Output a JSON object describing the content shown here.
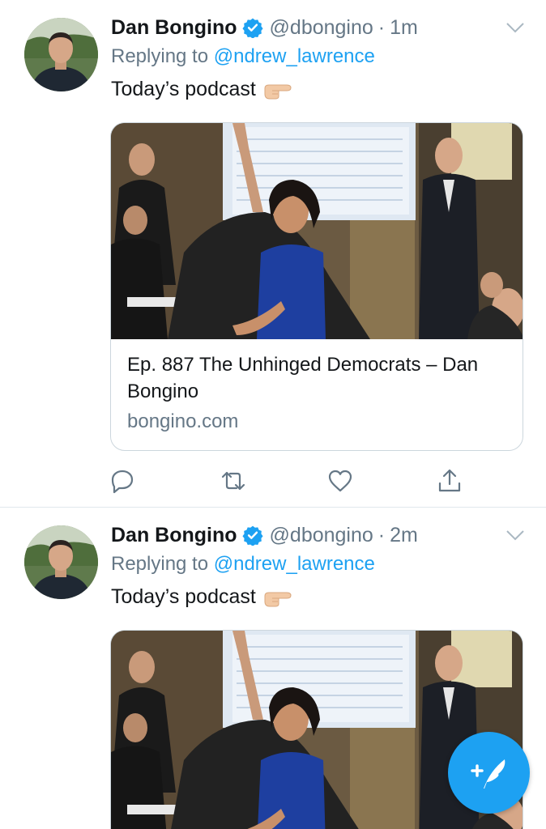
{
  "tweets": [
    {
      "author_name": "Dan Bongino",
      "handle": "@dbongino",
      "separator": "·",
      "time": "1m",
      "reply_prefix": "Replying to",
      "reply_mention": "@ndrew_lawrence",
      "text": "Today’s podcast",
      "emoji": "pointing-right-hand-emoji",
      "card": {
        "title": "Ep. 887 The Unhinged Democrats – Dan Bongino",
        "domain": "bongino.com"
      }
    },
    {
      "author_name": "Dan Bongino",
      "handle": "@dbongino",
      "separator": "·",
      "time": "2m",
      "reply_prefix": "Replying to",
      "reply_mention": "@ndrew_lawrence",
      "text": "Today’s podcast",
      "emoji": "pointing-right-hand-emoji"
    }
  ],
  "actions": [
    "reply-icon",
    "retweet-icon",
    "like-icon",
    "share-icon"
  ],
  "compose_button": "compose-tweet-icon",
  "colors": {
    "accent": "#1da1f2",
    "secondary_text": "#657786",
    "primary_text": "#14171a",
    "divider": "#e1e8ed"
  }
}
